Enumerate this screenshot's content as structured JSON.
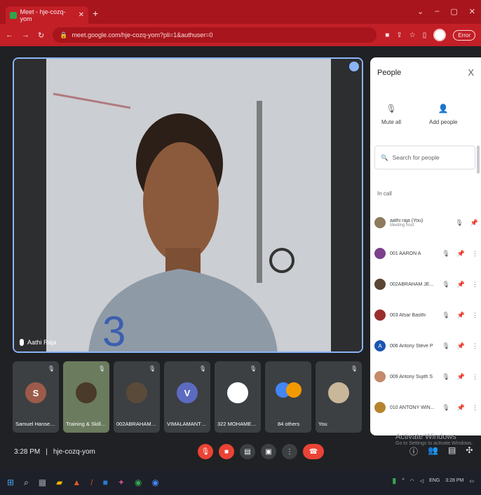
{
  "browser": {
    "tab_title": "Meet - hje-cozq-yom",
    "tab_close": "✕",
    "new_tab": "+",
    "url": "meet.google.com/hje-cozq-yom?pli=1&authuser=0",
    "update_label": "Error"
  },
  "stage": {
    "speaker_name": "Aathi Raja"
  },
  "tiles": [
    {
      "initial": "S",
      "name": "Samuel Hansen R",
      "color": "#9c5b4a"
    },
    {
      "initial": "",
      "name": "Training & Skill F...",
      "color": "#6b7b5e"
    },
    {
      "initial": "",
      "name": "002ABRAHAM J...",
      "color": "#5a4a3a"
    },
    {
      "initial": "V",
      "name": "VIMALAMANTHI...",
      "color": "#5c6bc0"
    },
    {
      "initial": "",
      "name": "322 MOHAMED...",
      "color": "#444"
    },
    {
      "initial": "",
      "name": "84 others",
      "color": "#3c4043"
    },
    {
      "initial": "",
      "name": "You",
      "color": "#7a6a55"
    }
  ],
  "bottom": {
    "time": "3:28 PM",
    "meeting_code": "hje-cozq-yom",
    "activate_title": "Activate Windows",
    "activate_sub": "Go to Settings to activate Windows."
  },
  "people": {
    "title": "People",
    "close": "X",
    "mute_all": "Mute all",
    "add_people": "Add people",
    "search_placeholder": "Search for people",
    "in_call": "In call",
    "list": [
      {
        "name": "aathi raja (You)",
        "sub": "Meeting host",
        "color": "#8d7a5c",
        "initial": ""
      },
      {
        "name": "001 AARON A",
        "sub": "",
        "color": "#7b3f8c",
        "initial": ""
      },
      {
        "name": "002ABRAHAM JE...",
        "sub": "",
        "color": "#5a4633",
        "initial": ""
      },
      {
        "name": "003 Afsar Basthi",
        "sub": "",
        "color": "#9b2d2d",
        "initial": ""
      },
      {
        "name": "006 Antony Steve P",
        "sub": "",
        "color": "#1a56b0",
        "initial": "A"
      },
      {
        "name": "009 Antony Sujith S",
        "sub": "",
        "color": "#c48a6b",
        "initial": ""
      },
      {
        "name": "010 ANTONY WIN...",
        "sub": "",
        "color": "#b7842e",
        "initial": ""
      }
    ]
  },
  "taskbar": {
    "lang": "ENG",
    "clock": "3:28 PM"
  }
}
